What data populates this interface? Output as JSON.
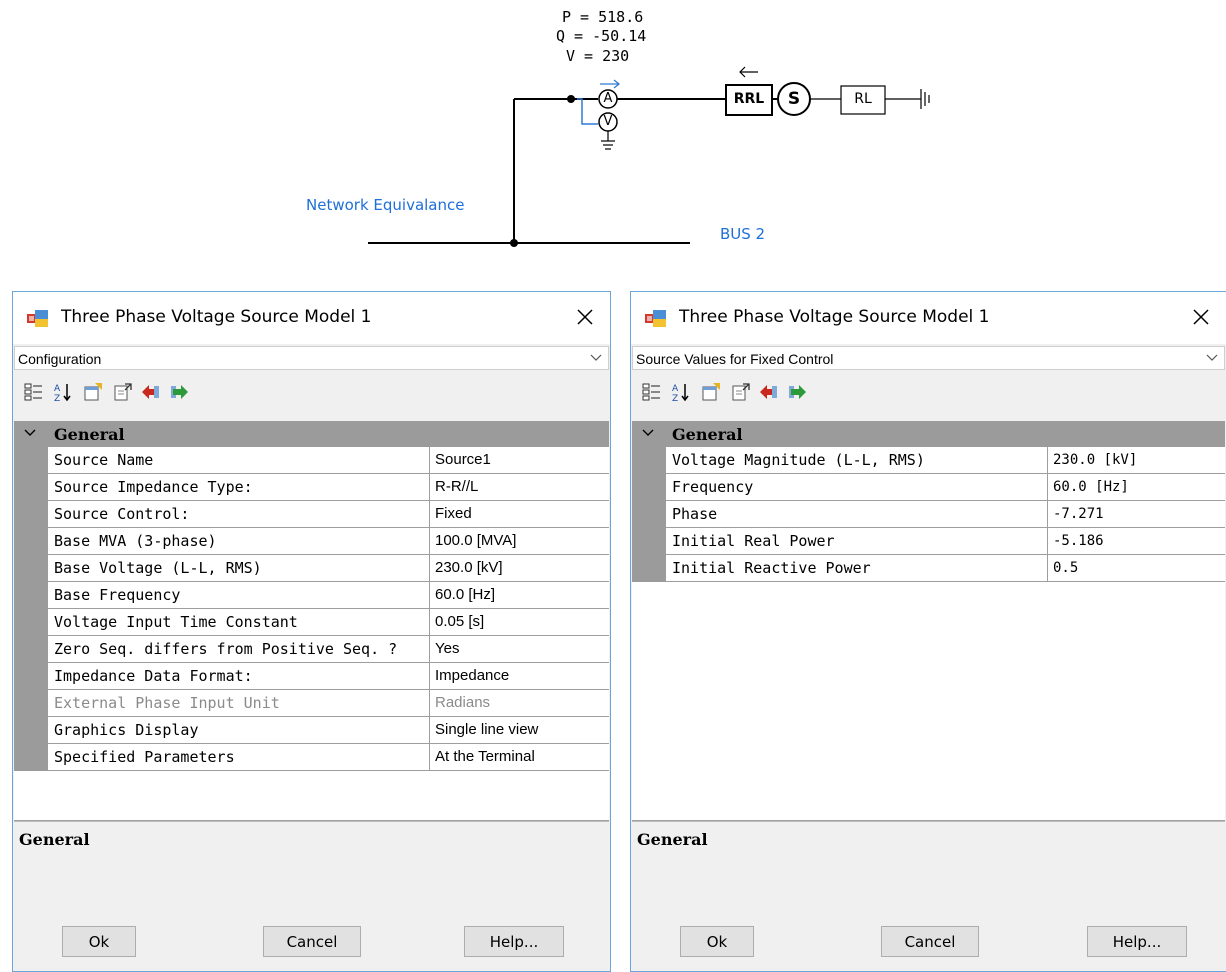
{
  "schematic": {
    "readout_p": "P = 518.6",
    "readout_q": "Q = -50.14",
    "readout_v": "V = 230",
    "ammeter_symbol": "A",
    "voltmeter_symbol": "V",
    "source_symbol": "S",
    "rrl_label": "RRL",
    "rl_label": "RL",
    "network_label": "Network Equivalance",
    "bus_label": "BUS 2"
  },
  "dialogs": [
    {
      "title": "Three Phase Voltage Source Model 1",
      "category": "Configuration",
      "group": "General",
      "properties": [
        {
          "name": "Source Name",
          "value": "Source1",
          "disabled": false
        },
        {
          "name": "Source Impedance Type:",
          "value": "R-R//L",
          "disabled": false
        },
        {
          "name": "Source Control:",
          "value": "Fixed",
          "disabled": false
        },
        {
          "name": "Base MVA (3-phase)",
          "value": "100.0 [MVA]",
          "disabled": false
        },
        {
          "name": "Base Voltage (L-L, RMS)",
          "value": "230.0 [kV]",
          "disabled": false
        },
        {
          "name": "Base Frequency",
          "value": "60.0 [Hz]",
          "disabled": false
        },
        {
          "name": "Voltage Input Time Constant",
          "value": "0.05 [s]",
          "disabled": false
        },
        {
          "name": "Zero Seq. differs from Positive Seq. ?",
          "value": "Yes",
          "disabled": false
        },
        {
          "name": "Impedance Data Format:",
          "value": "Impedance",
          "disabled": false
        },
        {
          "name": "External Phase Input Unit",
          "value": "Radians",
          "disabled": true
        },
        {
          "name": "Graphics Display",
          "value": "Single line view",
          "disabled": false
        },
        {
          "name": "Specified Parameters",
          "value": "At the Terminal",
          "disabled": false
        }
      ],
      "description_title": "General",
      "buttons": {
        "ok": "Ok",
        "cancel": "Cancel",
        "help": "Help..."
      }
    },
    {
      "title": "Three Phase Voltage Source Model 1",
      "category": "Source Values for Fixed Control",
      "group": "General",
      "properties": [
        {
          "name": "Voltage Magnitude (L-L, RMS)",
          "value": "230.0 [kV]",
          "disabled": false
        },
        {
          "name": "Frequency",
          "value": "60.0 [Hz]",
          "disabled": false
        },
        {
          "name": "Phase",
          "value": "-7.271",
          "disabled": false
        },
        {
          "name": "Initial Real Power",
          "value": "-5.186",
          "disabled": false
        },
        {
          "name": "Initial Reactive Power",
          "value": "0.5",
          "disabled": false
        }
      ],
      "description_title": "General",
      "buttons": {
        "ok": "Ok",
        "cancel": "Cancel",
        "help": "Help..."
      }
    }
  ],
  "toolbar_icons": [
    "categorized-icon",
    "sort-alphabetical-icon",
    "property-pages-icon",
    "export-icon",
    "red-arrow-icon",
    "green-arrow-icon"
  ],
  "colors": {
    "label_blue": "#1e6fd9",
    "meter_arrow": "#2f7ad6",
    "grid_gutter": "#9b9b9b",
    "dialog_border": "#6aa6dc",
    "dialog_background": "#f0f0f0"
  }
}
